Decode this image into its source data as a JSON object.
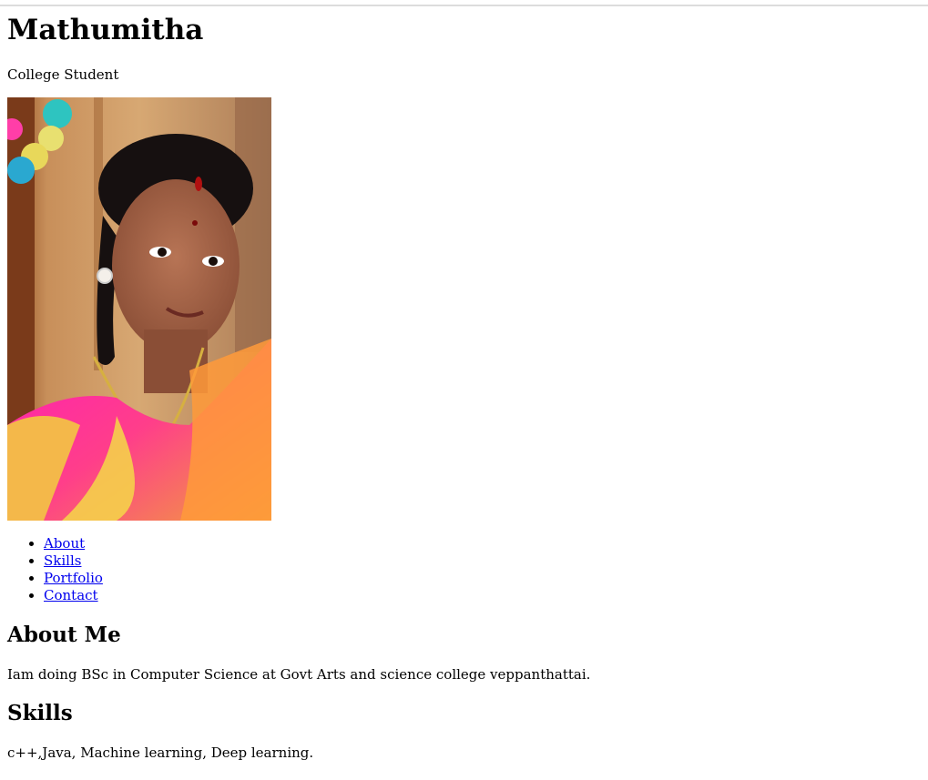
{
  "header": {
    "name": "Mathumitha",
    "tagline": "College Student"
  },
  "photo": {
    "alt": "Mathumitha"
  },
  "nav": {
    "items": [
      {
        "label": "About"
      },
      {
        "label": "Skills"
      },
      {
        "label": "Portfolio"
      },
      {
        "label": "Contact"
      }
    ]
  },
  "about": {
    "heading": "About Me",
    "text": "Iam doing BSc in Computer Science at Govt Arts and science college veppanthattai."
  },
  "skills": {
    "heading": "Skills",
    "text": "c++,Java, Machine learning, Deep learning."
  },
  "colors": {
    "link": "#0000ee",
    "text": "#000000",
    "background": "#ffffff"
  }
}
